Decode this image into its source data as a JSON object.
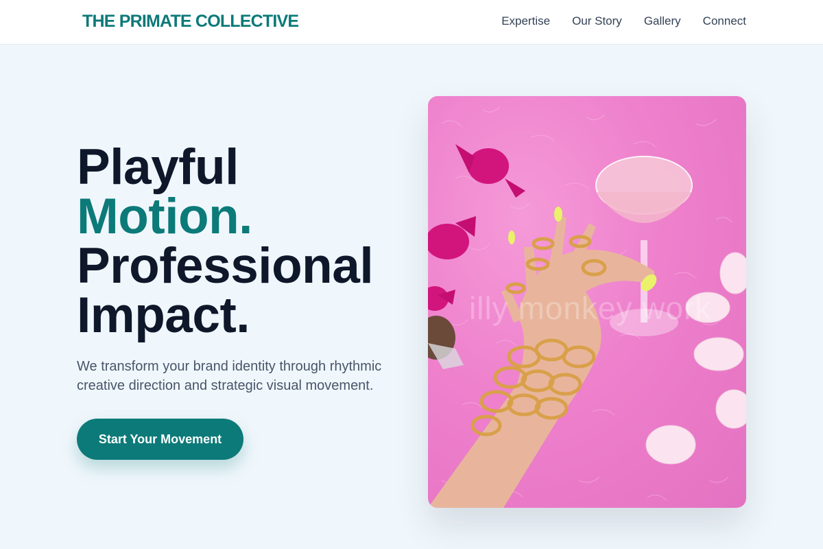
{
  "header": {
    "brand": "THE PRIMATE COLLECTIVE",
    "nav": [
      {
        "label": "Expertise"
      },
      {
        "label": "Our Story"
      },
      {
        "label": "Gallery"
      },
      {
        "label": "Connect"
      }
    ]
  },
  "hero": {
    "headline": {
      "line1": "Playful",
      "line2": "Motion.",
      "line3": "Professional",
      "line4": "Impact."
    },
    "subtitle": "We transform your brand identity through rhythmic creative direction and strategic visual movement.",
    "cta_label": "Start Your Movement"
  },
  "image": {
    "watermark": "illy monkey work",
    "subject": "hand-with-cocktail-glass-on-pink-fur"
  },
  "colors": {
    "accent": "#0c7a78",
    "text": "#0f172a",
    "muted": "#475569",
    "background": "#f0f7fc",
    "header_bg": "#ffffff",
    "photo_pink": "#ee80cc"
  }
}
